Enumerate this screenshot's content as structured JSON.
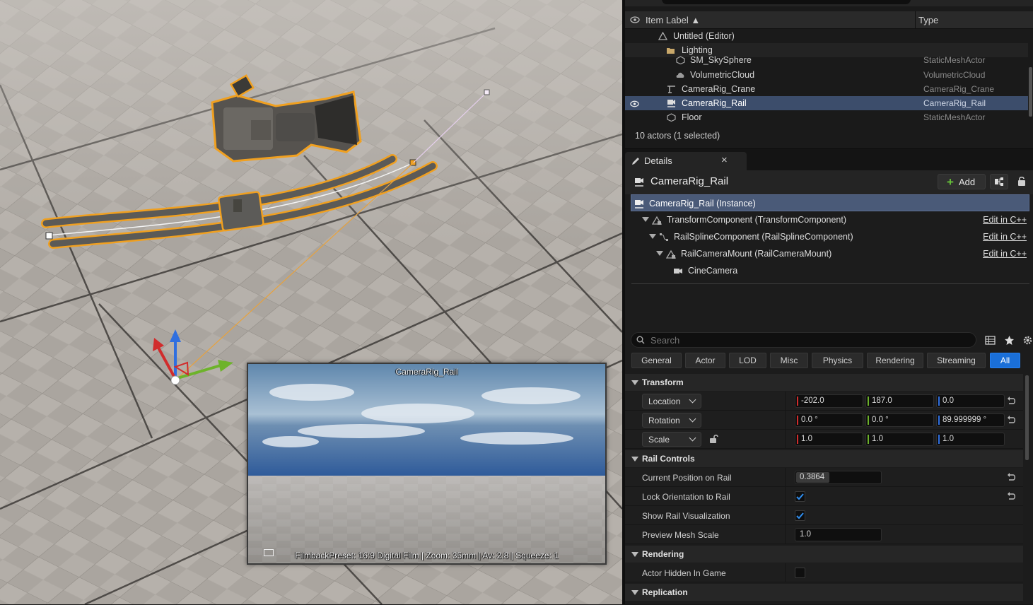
{
  "viewport": {
    "pip_title": "CameraRig_Rail",
    "pip_info": "FilmbackPreset: 16:9 Digital Film | Zoom: 35mm | Av: 2.8 | Squeeze: 1"
  },
  "outliner": {
    "col_label": "Item Label ▲",
    "col_type": "Type",
    "rows": [
      {
        "label": "Untitled (Editor)",
        "type": "",
        "icon": "level-icon"
      },
      {
        "label": "Lighting",
        "type": "",
        "icon": "folder-icon"
      },
      {
        "label": "SM_SkySphere",
        "type": "StaticMeshActor",
        "icon": "static-mesh-icon"
      },
      {
        "label": "VolumetricCloud",
        "type": "VolumetricCloud",
        "icon": "cloud-icon"
      },
      {
        "label": "CameraRig_Crane",
        "type": "CameraRig_Crane",
        "icon": "crane-icon"
      },
      {
        "label": "CameraRig_Rail",
        "type": "CameraRig_Rail",
        "icon": "rail-icon"
      },
      {
        "label": "Floor",
        "type": "StaticMeshActor",
        "icon": "static-mesh-icon"
      }
    ],
    "count": "10 actors (1 selected)"
  },
  "details": {
    "tab_label": "Details",
    "tab_close": "×",
    "actor_name": "CameraRig_Rail",
    "add_label": "Add",
    "components": [
      {
        "label": "CameraRig_Rail (Instance)",
        "edit": ""
      },
      {
        "label": "TransformComponent (TransformComponent)",
        "edit": "Edit in C++"
      },
      {
        "label": "RailSplineComponent (RailSplineComponent)",
        "edit": "Edit in C++"
      },
      {
        "label": "RailCameraMount (RailCameraMount)",
        "edit": "Edit in C++"
      },
      {
        "label": "CineCamera",
        "edit": ""
      }
    ],
    "search_placeholder": "Search",
    "filters": [
      "General",
      "Actor",
      "LOD",
      "Misc",
      "Physics",
      "Rendering",
      "Streaming",
      "All"
    ],
    "transform": {
      "category": "Transform",
      "location_label": "Location",
      "rotation_label": "Rotation",
      "scale_label": "Scale",
      "location": [
        "-202.0",
        "187.0",
        "0.0"
      ],
      "rotation": [
        "0.0 °",
        "0.0 °",
        "89.999999 °"
      ],
      "scale": [
        "1.0",
        "1.0",
        "1.0"
      ]
    },
    "rail_controls": {
      "category": "Rail Controls",
      "current_position_label": "Current Position on Rail",
      "current_position": "0.3864",
      "current_position_fraction": 0.3864,
      "lock_orientation_label": "Lock Orientation to Rail",
      "lock_orientation": true,
      "show_rail_label": "Show Rail Visualization",
      "show_rail": true,
      "preview_scale_label": "Preview Mesh Scale",
      "preview_scale": "1.0"
    },
    "rendering": {
      "category": "Rendering",
      "actor_hidden_label": "Actor Hidden In Game",
      "actor_hidden": false
    },
    "replication": {
      "category": "Replication"
    }
  },
  "colors": {
    "accent": "#1a6fd8",
    "selection": "#3c4d6b",
    "x_axis": "#d12c2c",
    "y_axis": "#6db32a",
    "z_axis": "#2f6fe0",
    "highlight_outline": "#f0a020"
  }
}
